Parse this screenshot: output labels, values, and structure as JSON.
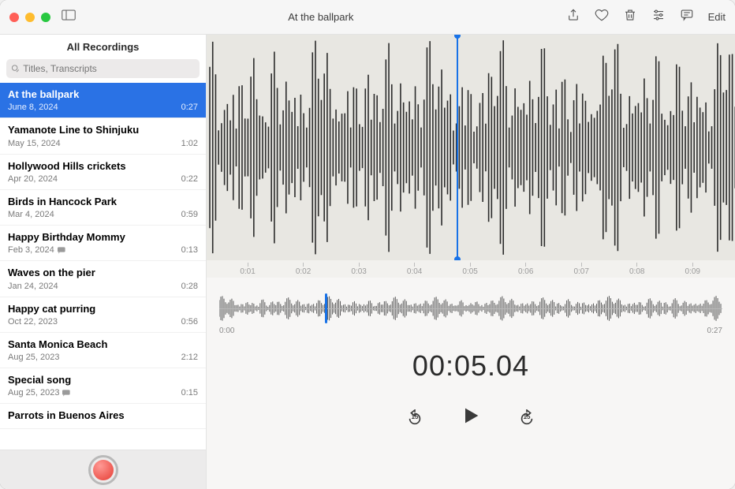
{
  "window": {
    "title": "At the ballpark",
    "edit_label": "Edit"
  },
  "sidebar": {
    "heading": "All Recordings",
    "search_placeholder": "Titles, Transcripts",
    "recordings": [
      {
        "title": "At the ballpark",
        "date": "June 8, 2024",
        "duration": "0:27",
        "selected": true,
        "has_transcript": false
      },
      {
        "title": "Yamanote Line to Shinjuku",
        "date": "May 15, 2024",
        "duration": "1:02",
        "selected": false,
        "has_transcript": false
      },
      {
        "title": "Hollywood Hills crickets",
        "date": "Apr 20, 2024",
        "duration": "0:22",
        "selected": false,
        "has_transcript": false
      },
      {
        "title": "Birds in Hancock Park",
        "date": "Mar 4, 2024",
        "duration": "0:59",
        "selected": false,
        "has_transcript": false
      },
      {
        "title": "Happy Birthday Mommy",
        "date": "Feb 3, 2024",
        "duration": "0:13",
        "selected": false,
        "has_transcript": true
      },
      {
        "title": "Waves on the pier",
        "date": "Jan 24, 2024",
        "duration": "0:28",
        "selected": false,
        "has_transcript": false
      },
      {
        "title": "Happy cat purring",
        "date": "Oct 22, 2023",
        "duration": "0:56",
        "selected": false,
        "has_transcript": false
      },
      {
        "title": "Santa Monica Beach",
        "date": "Aug 25, 2023",
        "duration": "2:12",
        "selected": false,
        "has_transcript": false
      },
      {
        "title": "Special song",
        "date": "Aug 25, 2023",
        "duration": "0:15",
        "selected": false,
        "has_transcript": true
      },
      {
        "title": "Parrots in Buenos Aires",
        "date": "",
        "duration": "",
        "selected": false,
        "has_transcript": false
      }
    ]
  },
  "player": {
    "timeline_ticks": [
      "0:01",
      "0:02",
      "0:03",
      "0:04",
      "0:05",
      "0:06",
      "0:07",
      "0:08",
      "0:09"
    ],
    "mini_start": "0:00",
    "mini_end": "0:27",
    "current_time": "00:05.04",
    "skip_back_seconds": "15",
    "skip_fwd_seconds": "15",
    "playhead_position_pct": 47.3,
    "mini_playhead_position_pct": 21
  },
  "toolbar_icons": {
    "share": "share-icon",
    "favorite": "heart-icon",
    "delete": "trash-icon",
    "settings": "sliders-icon",
    "transcript": "speech-bubble-icon"
  }
}
